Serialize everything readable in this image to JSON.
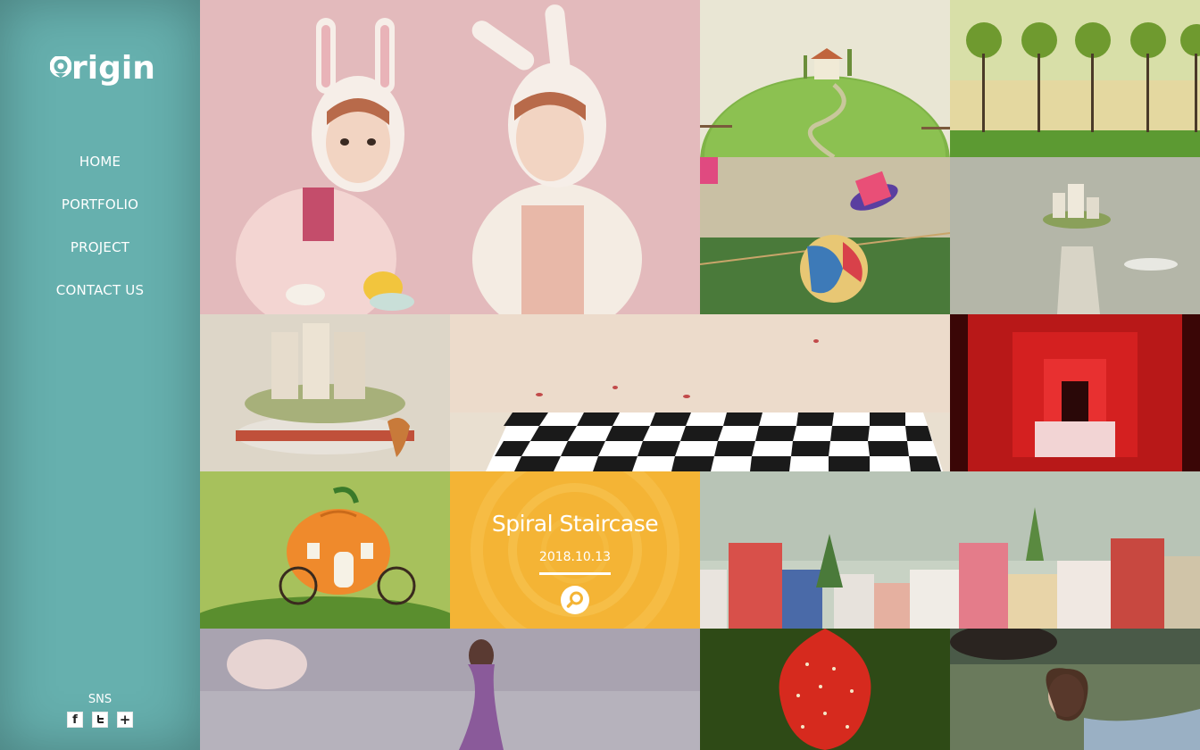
{
  "brand": {
    "logo_text": "rigin"
  },
  "nav": {
    "items": [
      {
        "label": "HOME"
      },
      {
        "label": "PORTFOLIO"
      },
      {
        "label": "PROJECT"
      },
      {
        "label": "CONTACT US"
      }
    ]
  },
  "sns": {
    "label": "SNS",
    "icons": [
      "facebook-icon",
      "twitter-icon",
      "plus-icon"
    ],
    "facebook_glyph": "f",
    "plus_glyph": "+"
  },
  "featured": {
    "title": "Spiral Staircase",
    "date": "2018.10.13",
    "icon": "search-icon"
  },
  "colors": {
    "sidebar": "#66b0ae",
    "feature_overlay": "#f4b435",
    "text": "#ffffff"
  },
  "gallery": {
    "tiles": [
      "bunny-girls-image",
      "hill-house-image",
      "trees-image",
      "top-hat-ball-image",
      "floating-castle-image",
      "castle-cake-image",
      "chessboard-image",
      "red-gates-image",
      "pumpkin-carriage-image",
      "spiral-staircase-image",
      "village-houses-image",
      "misty-woman-image",
      "strawberry-image",
      "woman-grass-image"
    ]
  }
}
